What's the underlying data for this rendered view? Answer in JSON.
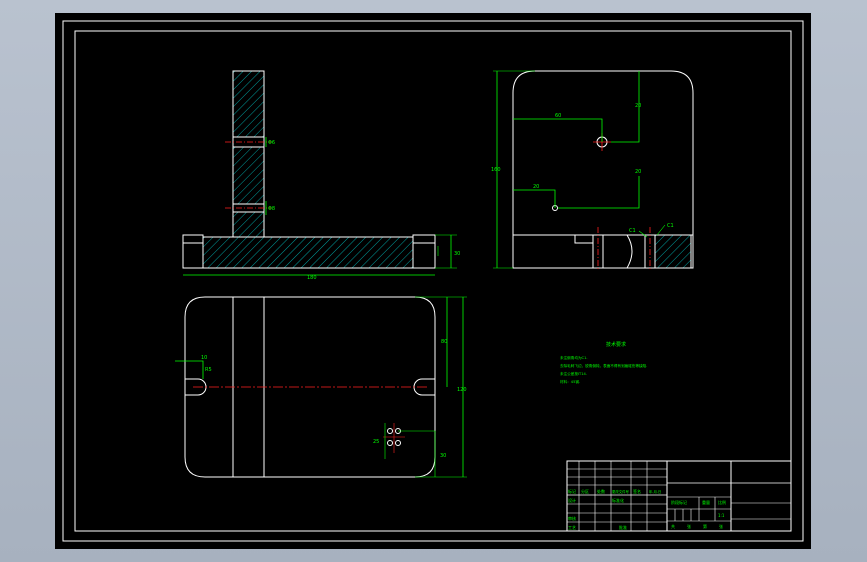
{
  "colors": {
    "background": "#000000",
    "line": "#ffffff",
    "dimension": "#00ff00",
    "centerline": "#ff2020",
    "hatch": "#00c8c8",
    "viewport_frame": "#a9b3c1"
  },
  "notes": {
    "title": "技术要求",
    "lines": [
      "未注倒角均为C1.",
      "去除毛刺飞边，锐角倒钝，表面不得有划痕碰伤等缺陷.",
      "未注公差按IT14.",
      "材料：45钢."
    ]
  },
  "title_block": {
    "left_rows": [
      [
        "标记",
        "处数",
        "分区",
        "更改文件号",
        "签名",
        "年.月.日"
      ],
      [
        "设计",
        "",
        "",
        "标准化",
        "",
        ""
      ],
      [
        "审核",
        "",
        "",
        "",
        "",
        ""
      ],
      [
        "工艺",
        "",
        "",
        "批准",
        "",
        ""
      ]
    ],
    "stage_label": "阶段标记",
    "weight_label": "重量",
    "scale_label": "比例",
    "scale_value": "1:1",
    "sheet_labels": [
      "共",
      "张",
      "第",
      "张"
    ]
  },
  "dimensions": {
    "front_width": "180",
    "front_base_h": "30",
    "front_hole_1": "Φ6",
    "front_hole_2": "Φ8",
    "side_height": "160",
    "side_hole_x": "60",
    "side_hole_low_x": "20",
    "side_hole_y": "20",
    "side_detail_1": "C1",
    "side_detail_2": "C1",
    "plan_height": "120",
    "plan_upper": "80",
    "plan_slot_w": "10",
    "plan_slot_r": "R5",
    "plan_holes_x": "30",
    "plan_holes_y": "25"
  }
}
